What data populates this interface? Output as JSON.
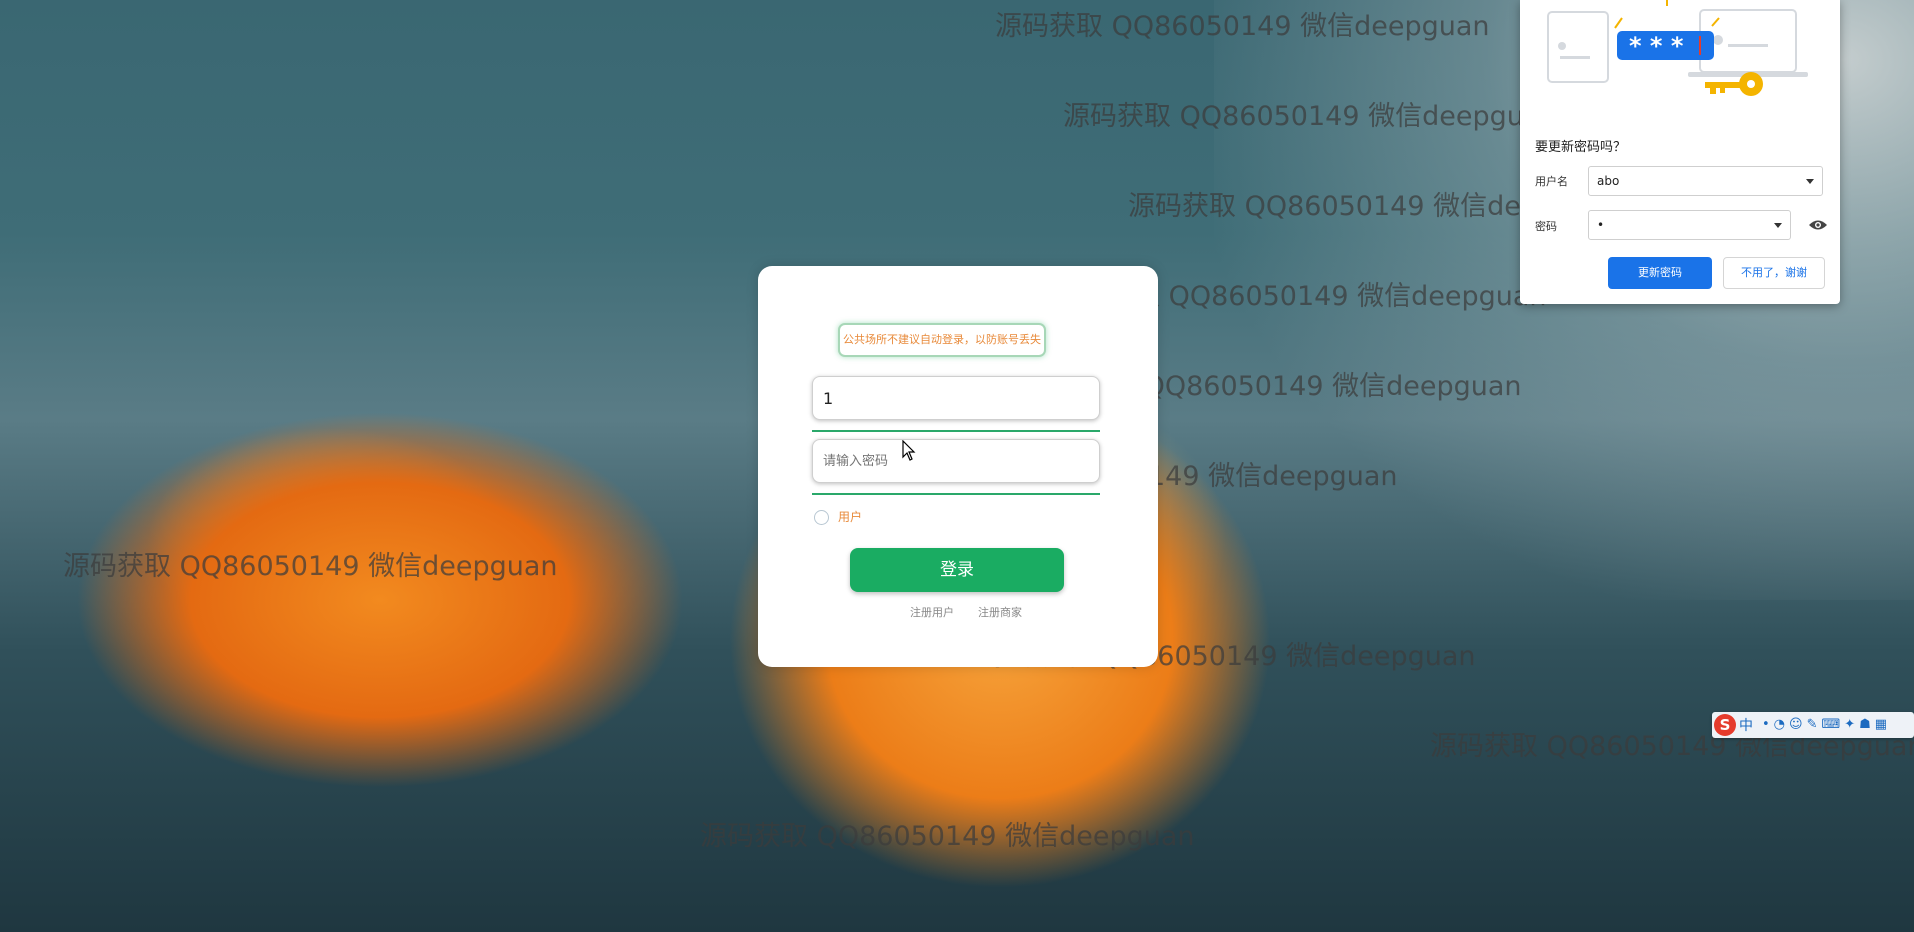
{
  "watermark": {
    "text": "源码获取 QQ86050149 微信deepguan",
    "color": "#3c3c3c"
  },
  "login": {
    "notice": "公共场所不建议自动登录，以防账号丢失",
    "username_value": "1",
    "password_placeholder": "请输入密码",
    "role_option": "用户",
    "submit_label": "登录",
    "register_user": "注册用户",
    "register_merchant": "注册商家",
    "accent": "#1aac62",
    "notice_color": "#e88a3a"
  },
  "password_popup": {
    "illustration_text": "* * *",
    "title": "要更新密码吗？",
    "username_label": "用户名",
    "username_value": "abo",
    "password_label": "密码",
    "password_value": "•",
    "update_button": "更新密码",
    "dismiss_button": "不用了，谢谢",
    "accent": "#1a73e8"
  },
  "ime": {
    "logo": "S",
    "mode": "中"
  }
}
